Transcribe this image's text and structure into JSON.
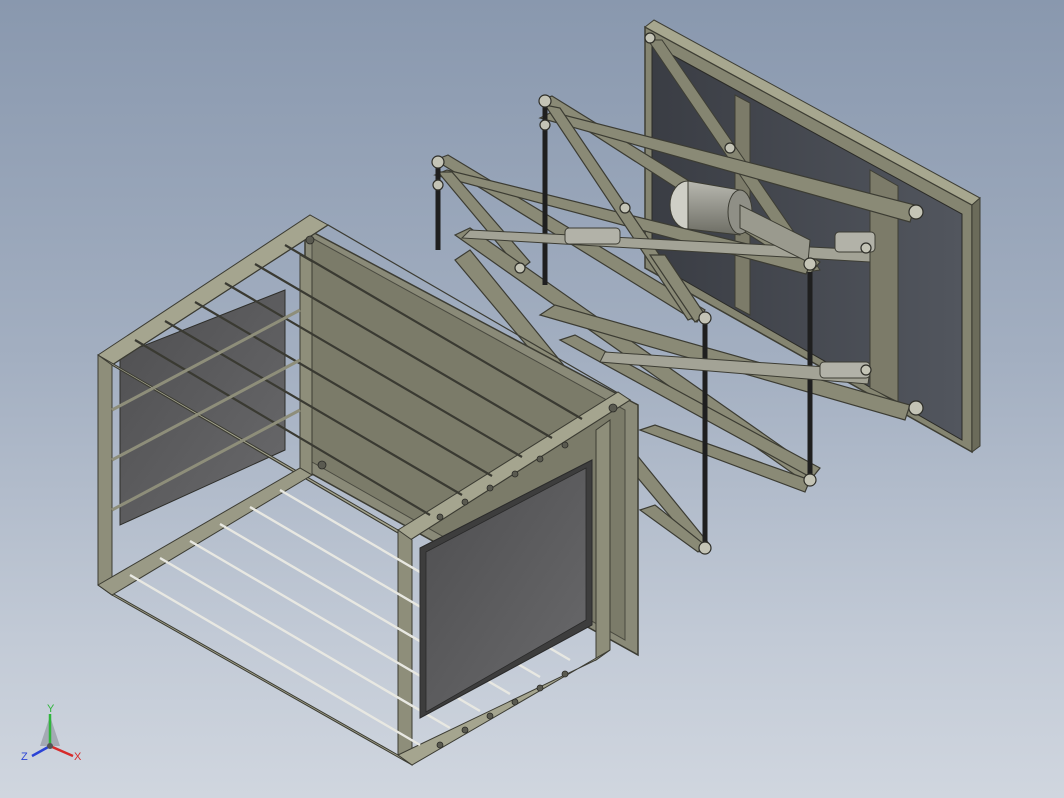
{
  "viewport": {
    "background_top": "#8998ae",
    "background_bottom": "#d0d6df"
  },
  "model": {
    "frame_color": "#7c7b69",
    "frame_dark": "#4d4c41",
    "panel_color": "#5b5b5b",
    "bar_color": "#2b2b2b"
  },
  "triad": {
    "y_label": "Y",
    "x_label": "X",
    "z_label": "Z",
    "y_color": "#2fb53c",
    "x_color": "#d62a2a",
    "z_color": "#2a43d6"
  }
}
